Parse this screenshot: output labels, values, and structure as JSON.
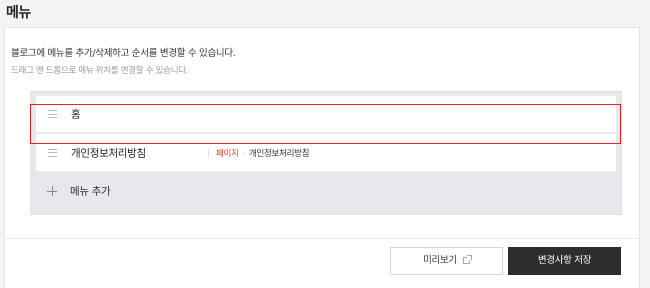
{
  "page": {
    "title": "메뉴"
  },
  "description": {
    "line1": "블로그에 메뉴를 추가/삭제하고 순서를 변경할 수 있습니다.",
    "line2": "드래그 앤 드롭으로 메뉴 위치를 변경할 수 있습니다."
  },
  "menu": {
    "items": [
      {
        "label": "홈"
      },
      {
        "label": "개인정보처리방침",
        "type": "페이지",
        "dot": "·",
        "page_name": "개인정보처리방침"
      }
    ],
    "add_label": "메뉴 추가"
  },
  "actions": {
    "preview_label": "미리보기",
    "save_label": "변경사항 저장"
  },
  "colors": {
    "accent_red": "#e2232a",
    "type_label": "#e8412c",
    "save_button_bg": "#2d2d2d"
  },
  "icons": {
    "drag": "drag-handle-icon",
    "add": "plus-icon",
    "external": "external-link-icon"
  }
}
